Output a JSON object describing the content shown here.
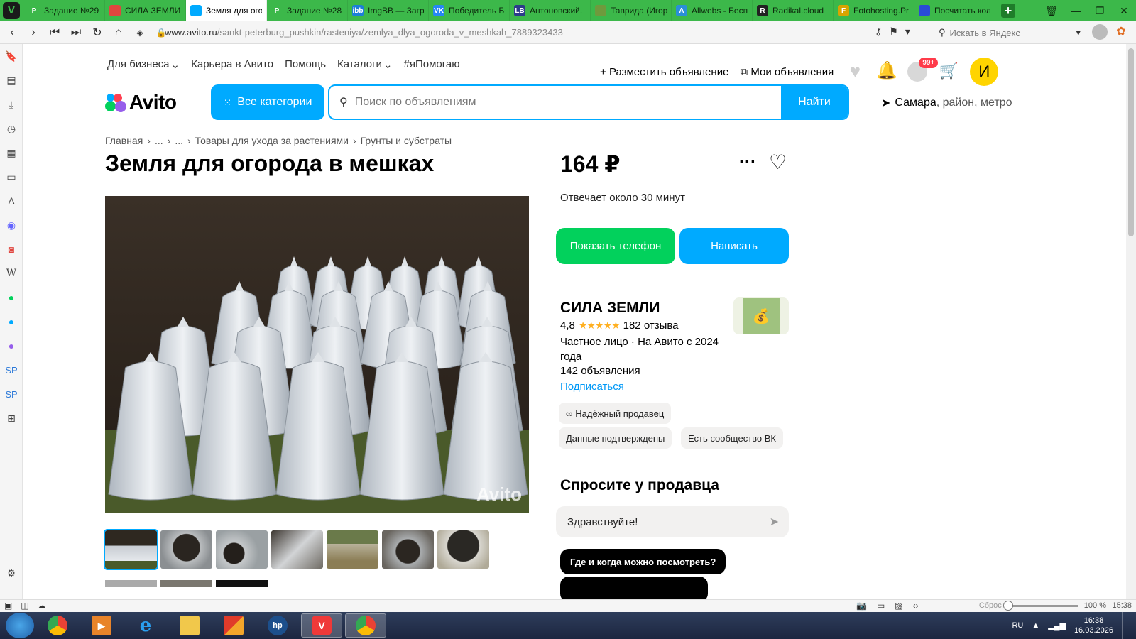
{
  "browser": {
    "tabs": [
      {
        "title": "Задание №29",
        "icon_color": "#3cb84a",
        "icon_letter": "P"
      },
      {
        "title": "СИЛА ЗЕМЛИ",
        "icon_color": "#e0453f",
        "icon_letter": ""
      },
      {
        "title": "Земля для ого",
        "icon_color": "#00aaff",
        "icon_letter": ""
      },
      {
        "title": "Задание №28",
        "icon_color": "#3cb84a",
        "icon_letter": "P"
      },
      {
        "title": "ImgBB — Загр",
        "icon_color": "#1d7fd8",
        "icon_letter": "ibb"
      },
      {
        "title": "Победитель Б",
        "icon_color": "#2787f5",
        "icon_letter": "VK"
      },
      {
        "title": "Антоновский.",
        "icon_color": "#2b3b8a",
        "icon_letter": "LB"
      },
      {
        "title": "Таврида (Игор",
        "icon_color": "#6f9a3d",
        "icon_letter": ""
      },
      {
        "title": "Allwebs - Бесп",
        "icon_color": "#2a8fd8",
        "icon_letter": "A"
      },
      {
        "title": "Radikal.cloud",
        "icon_color": "#222222",
        "icon_letter": "R"
      },
      {
        "title": "Fotohosting.Pr",
        "icon_color": "#d9a400",
        "icon_letter": "F"
      },
      {
        "title": "Посчитать кол",
        "icon_color": "#2a4bd8",
        "icon_letter": ""
      }
    ],
    "active_tab": 2,
    "url_prefix": "www.avito.ru",
    "url_path": "/sankt-peterburg_pushkin/rasteniya/zemlya_dlya_ogoroda_v_meshkah_7889323433",
    "search_placeholder": "Искать в Яндекс"
  },
  "topnav": {
    "left": [
      "Для бизнеса",
      "Карьера в Авито",
      "Помощь",
      "Каталоги",
      "#яПомогаю"
    ],
    "post_ad": "Разместить объявление",
    "my_ads": "Мои объявления",
    "messages_badge": "99+",
    "avatar_letter": "И"
  },
  "header": {
    "logo": "Avito",
    "categories_button": "Все категории",
    "search_placeholder": "Поиск по объявлениям",
    "search_button": "Найти",
    "location_city": "Самара",
    "location_rest": ", район, метро"
  },
  "breadcrumb": [
    "Главная",
    "...",
    "...",
    "Товары для ухода за растениями",
    "Грунты и субстраты"
  ],
  "listing": {
    "title": "Земля для огорода в мешках",
    "price": "164 ₽",
    "response_time": "Отвечает около 30 минут",
    "show_phone": "Показать телефон",
    "write": "Написать",
    "photo_watermark": "Avito",
    "thumbnails": 7
  },
  "seller": {
    "name": "СИЛА ЗЕМЛИ",
    "rating": "4,8",
    "stars": "★★★★★",
    "reviews": "182 отзыва",
    "type": "Частное лицо · На Авито с 2024 года",
    "ads_count": "142 объявления",
    "subscribe": "Подписаться",
    "badges": [
      "Надёжный продавец",
      "Данные подтверждены",
      "Есть сообщество ВК"
    ]
  },
  "ask": {
    "title": "Спросите у продавца",
    "message": "Здравствуйте!",
    "questions": [
      "Где и когда можно посмотреть?"
    ]
  },
  "statusbar": {
    "reset": "Сброс",
    "zoom": "100 %",
    "time": "15:38"
  },
  "taskbar": {
    "lang": "RU",
    "time": "16:38",
    "date": "16.03.2026"
  },
  "colors": {
    "accent_blue": "#00aaff",
    "accent_green": "#02d15c",
    "vivaldi_green": "#3cb84a"
  }
}
